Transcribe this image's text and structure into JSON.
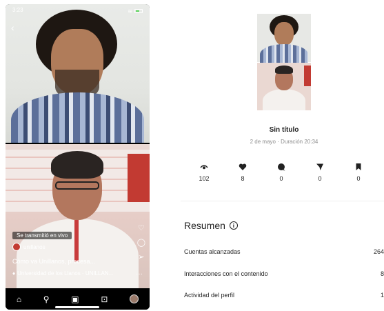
{
  "phone": {
    "status": {
      "time": "3:23"
    },
    "live_label": "Se transmitió en vivo",
    "username": "unillanos",
    "title_line": "Cómo va Unillanos, procesa...",
    "sub_line": "Universidad de los Llanos · UNILLAN...",
    "nav": [
      "home-icon",
      "search-icon",
      "reels-icon",
      "shop-icon",
      "profile-avatar"
    ]
  },
  "insights": {
    "video_title": "Sin título",
    "meta": "2 de mayo · Duración 20:34",
    "stats": [
      {
        "icon": "eye-icon",
        "value": "102"
      },
      {
        "icon": "heart-icon",
        "value": "8"
      },
      {
        "icon": "comment-icon",
        "value": "0"
      },
      {
        "icon": "send-icon",
        "value": "0"
      },
      {
        "icon": "bookmark-icon",
        "value": "0"
      }
    ],
    "section_title": "Resumen",
    "metrics": [
      {
        "label": "Cuentas alcanzadas",
        "value": "264"
      },
      {
        "label": "Interacciones con el contenido",
        "value": "8"
      },
      {
        "label": "Actividad del perfil",
        "value": "1"
      }
    ]
  }
}
